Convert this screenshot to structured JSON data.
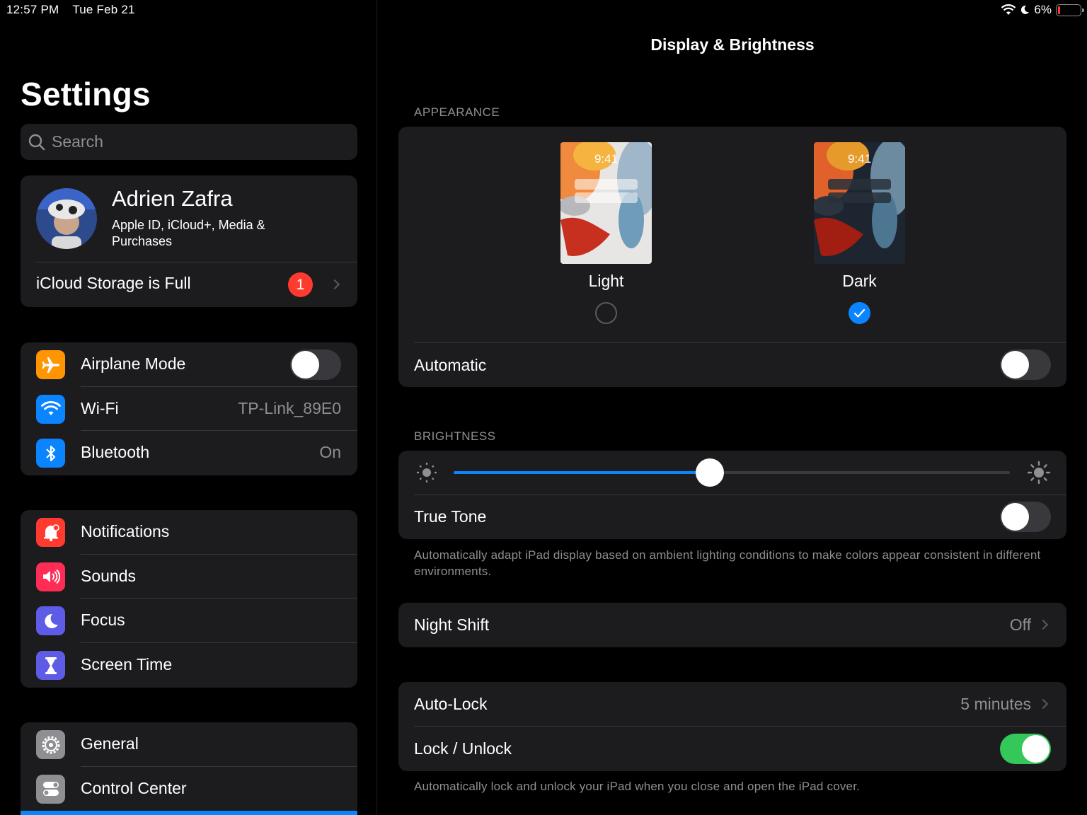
{
  "status": {
    "time": "12:57 PM",
    "date": "Tue Feb 21",
    "battery": "6%",
    "battery_color": "#ff3b30"
  },
  "sidebar": {
    "title": "Settings",
    "search_placeholder": "Search",
    "profile": {
      "name": "Adrien Zafra",
      "subtitle": "Apple ID, iCloud+, Media & Purchases"
    },
    "icloud": {
      "label": "iCloud Storage is Full",
      "badge": "1"
    },
    "connectivity": [
      {
        "label": "Airplane Mode",
        "icon": "airplane-icon",
        "color": "#ff9500",
        "toggle": false
      },
      {
        "label": "Wi-Fi",
        "icon": "wifi-icon",
        "color": "#0a84ff",
        "value": "TP-Link_89E0"
      },
      {
        "label": "Bluetooth",
        "icon": "bluetooth-icon",
        "color": "#0a84ff",
        "value": "On"
      }
    ],
    "alerts": [
      {
        "label": "Notifications",
        "icon": "notifications-icon",
        "color": "#ff3b30"
      },
      {
        "label": "Sounds",
        "icon": "sounds-icon",
        "color": "#ff2d55"
      },
      {
        "label": "Focus",
        "icon": "focus-moon-icon",
        "color": "#5e5ce6"
      },
      {
        "label": "Screen Time",
        "icon": "hourglass-icon",
        "color": "#5e5ce6"
      }
    ],
    "general": [
      {
        "label": "General",
        "icon": "gear-icon",
        "color": "#8e8e93"
      },
      {
        "label": "Control Center",
        "icon": "control-center-icon",
        "color": "#8e8e93"
      }
    ]
  },
  "detail": {
    "title": "Display & Brightness",
    "appearance": {
      "header": "APPEARANCE",
      "phone_time": "9:41",
      "light_label": "Light",
      "dark_label": "Dark",
      "selected": "Dark",
      "automatic_label": "Automatic",
      "automatic_on": false
    },
    "brightness": {
      "header": "BRIGHTNESS",
      "level": 0.46,
      "true_tone_label": "True Tone",
      "true_tone_on": false,
      "footer": "Automatically adapt iPad display based on ambient lighting conditions to make colors appear consistent in different environments."
    },
    "night_shift": {
      "label": "Night Shift",
      "value": "Off"
    },
    "auto_lock": {
      "label": "Auto-Lock",
      "value": "5 minutes"
    },
    "lock_unlock": {
      "label": "Lock / Unlock",
      "on": true,
      "footer": "Automatically lock and unlock your iPad when you close and open the iPad cover."
    }
  }
}
